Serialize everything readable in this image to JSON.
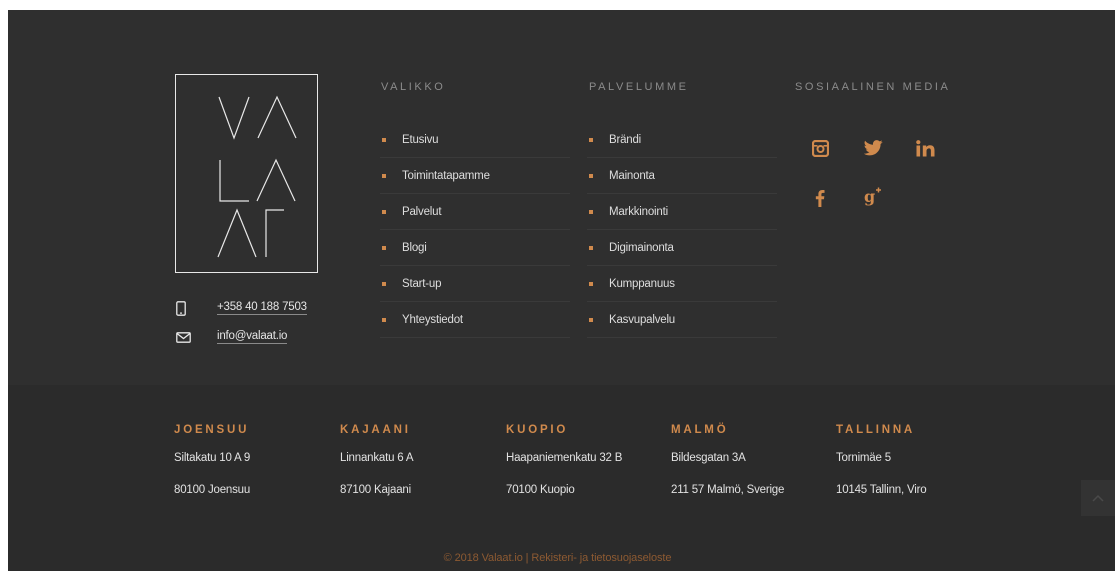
{
  "brand": {
    "logo_name": "VALAAT",
    "logo_letters": [
      "VA",
      "LA",
      "AT"
    ]
  },
  "contact": {
    "phone": "+358 40 188 7503",
    "email": "info@valaat.io"
  },
  "menu": {
    "heading": "VALIKKO",
    "items": [
      "Etusivu",
      "Toimintatapamme",
      "Palvelut",
      "Blogi",
      "Start-up",
      "Yhteystiedot"
    ]
  },
  "services": {
    "heading": "PALVELUMME",
    "items": [
      "Brändi",
      "Mainonta",
      "Markkinointi",
      "Digimainonta",
      "Kumppanuus",
      "Kasvupalvelu"
    ]
  },
  "social": {
    "heading": "SOSIAALINEN MEDIA",
    "icons": [
      "instagram-icon",
      "twitter-icon",
      "linkedin-icon",
      "facebook-icon",
      "google-plus-icon"
    ]
  },
  "offices": [
    {
      "city": "JOENSUU",
      "street": "Siltakatu 10 A 9",
      "zip": "80100 Joensuu"
    },
    {
      "city": "KAJAANI",
      "street": "Linnankatu 6 A",
      "zip": "87100 Kajaani"
    },
    {
      "city": "KUOPIO",
      "street": "Haapaniemenkatu 32 B",
      "zip": "70100 Kuopio"
    },
    {
      "city": "MALMÖ",
      "street": "Bildesgatan 3A",
      "zip": "211 57 Malmö, Sverige"
    },
    {
      "city": "TALLINNA",
      "street": "Tornimäe 5",
      "zip": "10145 Tallinn, Viro"
    }
  ],
  "footer": {
    "copyright": "© 2018 Valaat.io | ",
    "privacy_link": "Rekisteri- ja tietosuojaseloste"
  },
  "colors": {
    "background_top": "#2f2f2f",
    "background_bottom": "#2b2b2b",
    "accent": "#d08a4d",
    "text": "#e2e2e2",
    "heading": "#8b8b8b"
  }
}
